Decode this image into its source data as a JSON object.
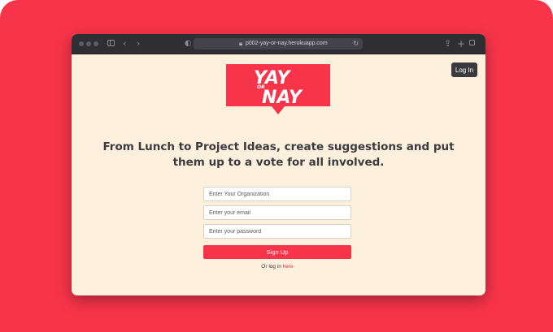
{
  "browser": {
    "url": "p002-yay-or-nay.herokuapp.com"
  },
  "header": {
    "login_label": "Log In"
  },
  "logo": {
    "line1": "YAY",
    "middle": "OR",
    "line2": "NAY",
    "color": "#f8344a"
  },
  "main": {
    "headline": "From Lunch to Project Ideas, create suggestions and put them up to a vote for all involved."
  },
  "form": {
    "organization_placeholder": "Enter Your Organization",
    "email_placeholder": "Enter your email",
    "password_placeholder": "Enter your password",
    "signup_label": "Sign Up",
    "login_prefix": "Or log in ",
    "login_link": "here"
  },
  "colors": {
    "accent": "#f8344a",
    "page_bg": "#fdf1dd",
    "dark_button": "#3a3a3c"
  }
}
